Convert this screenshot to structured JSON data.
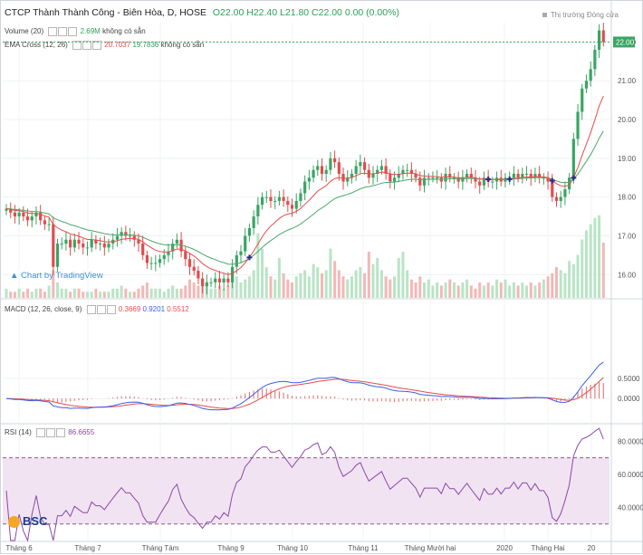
{
  "header": {
    "title": "CTCP Thành Thành Công - Biên Hòa, D, HOSE",
    "ohlc": "O22.00  H22.40  L21.80  C22.00  0.00 (0.00%)",
    "market_status": "Thị trường Đóng cửa"
  },
  "indicators": {
    "volume": {
      "label": "Volume (20)",
      "value": "2.69M",
      "na": "không có sẵn"
    },
    "ema": {
      "label": "EMA Cross (12, 26)",
      "v1": "20.7037",
      "v2": "19.7836",
      "na": "không có sẵn"
    },
    "macd": {
      "label": "MACD (12, 26, close, 9)",
      "v1": "0.3669",
      "v2": "0.9201",
      "v3": "0.5512"
    },
    "rsi": {
      "label": "RSI (14)",
      "value": "86.6655"
    }
  },
  "branding": {
    "tradingview": "Chart by TradingView",
    "broker": "BSC"
  },
  "chart_data": {
    "type": "candlestick",
    "colors": {
      "up": "#3aa564",
      "down": "#e04d4d",
      "ema_fast": "#e84c4c",
      "ema_slow": "#4aa96c",
      "macd": "#3d5ee8",
      "signal": "#e84c4c",
      "rsi": "#8a4aa8",
      "rsi_band": "#f1e3f2"
    },
    "last_price_label": "22.00",
    "price_axis": {
      "ticks": [
        "22.00",
        "21.00",
        "20.00",
        "19.00",
        "18.00",
        "17.00",
        "16.00"
      ],
      "ylim": [
        15.4,
        22.5
      ]
    },
    "macd_axis": {
      "ticks": [
        "0.5000",
        "0.0000"
      ],
      "ylim": [
        -0.6,
        2.4
      ]
    },
    "rsi_axis": {
      "ticks": [
        "80.0000",
        "60.0000",
        "40.0000"
      ],
      "ylim": [
        20,
        90
      ],
      "band": [
        30,
        70
      ]
    },
    "x_labels": [
      "Tháng 6",
      "Tháng 7",
      "Tháng Tám",
      "Tháng 9",
      "Tháng 10",
      "Tháng 11",
      "Tháng Mười hai",
      "2020",
      "Tháng Hai",
      "20"
    ],
    "close_series": [
      17.7,
      17.6,
      17.5,
      17.6,
      17.5,
      17.4,
      17.5,
      17.6,
      17.4,
      17.3,
      17.3,
      16.2,
      16.8,
      16.8,
      16.9,
      16.7,
      16.9,
      16.8,
      16.7,
      16.7,
      16.9,
      16.8,
      16.8,
      16.7,
      16.8,
      16.9,
      17.0,
      17.1,
      17.0,
      17.0,
      16.9,
      16.8,
      16.5,
      16.3,
      16.3,
      16.3,
      16.4,
      16.5,
      16.6,
      16.8,
      16.9,
      16.6,
      16.4,
      16.2,
      16.1,
      15.9,
      15.7,
      15.8,
      15.8,
      15.9,
      15.8,
      15.9,
      15.8,
      16.2,
      16.5,
      16.6,
      17.0,
      17.2,
      17.5,
      17.8,
      18.0,
      18.0,
      17.9,
      17.9,
      18.0,
      17.9,
      17.8,
      17.7,
      17.9,
      18.1,
      18.4,
      18.5,
      18.7,
      18.8,
      18.6,
      18.7,
      19.0,
      18.9,
      18.6,
      18.4,
      18.5,
      18.6,
      18.8,
      18.9,
      18.7,
      18.5,
      18.6,
      18.7,
      18.8,
      18.6,
      18.4,
      18.5,
      18.6,
      18.7,
      18.7,
      18.6,
      18.5,
      18.3,
      18.5,
      18.5,
      18.5,
      18.5,
      18.4,
      18.6,
      18.5,
      18.5,
      18.4,
      18.5,
      18.6,
      18.5,
      18.4,
      18.3,
      18.5,
      18.4,
      18.4,
      18.5,
      18.4,
      18.5,
      18.5,
      18.6,
      18.5,
      18.6,
      18.6,
      18.5,
      18.6,
      18.5,
      18.5,
      18.4,
      18.0,
      17.9,
      18.0,
      18.2,
      18.5,
      19.5,
      20.2,
      20.8,
      21.0,
      21.3,
      21.8,
      22.3,
      22.0
    ],
    "volume_millions": [
      0.3,
      0.2,
      0.2,
      0.3,
      0.2,
      0.3,
      0.2,
      0.3,
      0.3,
      0.2,
      0.4,
      0.9,
      0.5,
      0.3,
      0.3,
      0.2,
      0.3,
      0.3,
      0.2,
      0.2,
      0.2,
      0.3,
      0.2,
      0.2,
      0.2,
      0.3,
      0.3,
      0.4,
      0.3,
      0.2,
      0.2,
      0.3,
      0.4,
      0.5,
      0.3,
      0.3,
      0.3,
      0.2,
      0.3,
      0.4,
      0.3,
      0.3,
      0.4,
      0.6,
      0.5,
      0.4,
      0.6,
      0.5,
      0.3,
      0.3,
      0.4,
      0.3,
      0.4,
      0.6,
      0.7,
      0.5,
      0.6,
      0.7,
      0.9,
      2.1,
      1.6,
      1.0,
      0.7,
      0.6,
      1.3,
      0.8,
      0.6,
      0.5,
      0.7,
      0.8,
      0.9,
      0.7,
      1.1,
      1.0,
      0.8,
      0.9,
      1.6,
      1.2,
      0.9,
      0.7,
      0.6,
      0.7,
      0.9,
      1.0,
      0.8,
      1.5,
      1.1,
      1.3,
      0.9,
      0.7,
      0.6,
      0.7,
      1.3,
      1.5,
      0.9,
      0.6,
      0.5,
      0.7,
      0.5,
      0.6,
      0.4,
      0.5,
      0.4,
      0.5,
      0.6,
      0.5,
      0.4,
      0.5,
      0.6,
      0.4,
      0.3,
      0.5,
      0.4,
      0.5,
      0.4,
      0.6,
      0.5,
      0.6,
      0.4,
      0.5,
      0.4,
      0.5,
      0.4,
      0.5,
      0.4,
      0.5,
      0.6,
      0.7,
      0.8,
      1.0,
      0.9,
      0.8,
      1.2,
      1.1,
      1.4,
      1.9,
      2.2,
      2.4,
      2.6,
      2.69,
      1.8
    ]
  }
}
